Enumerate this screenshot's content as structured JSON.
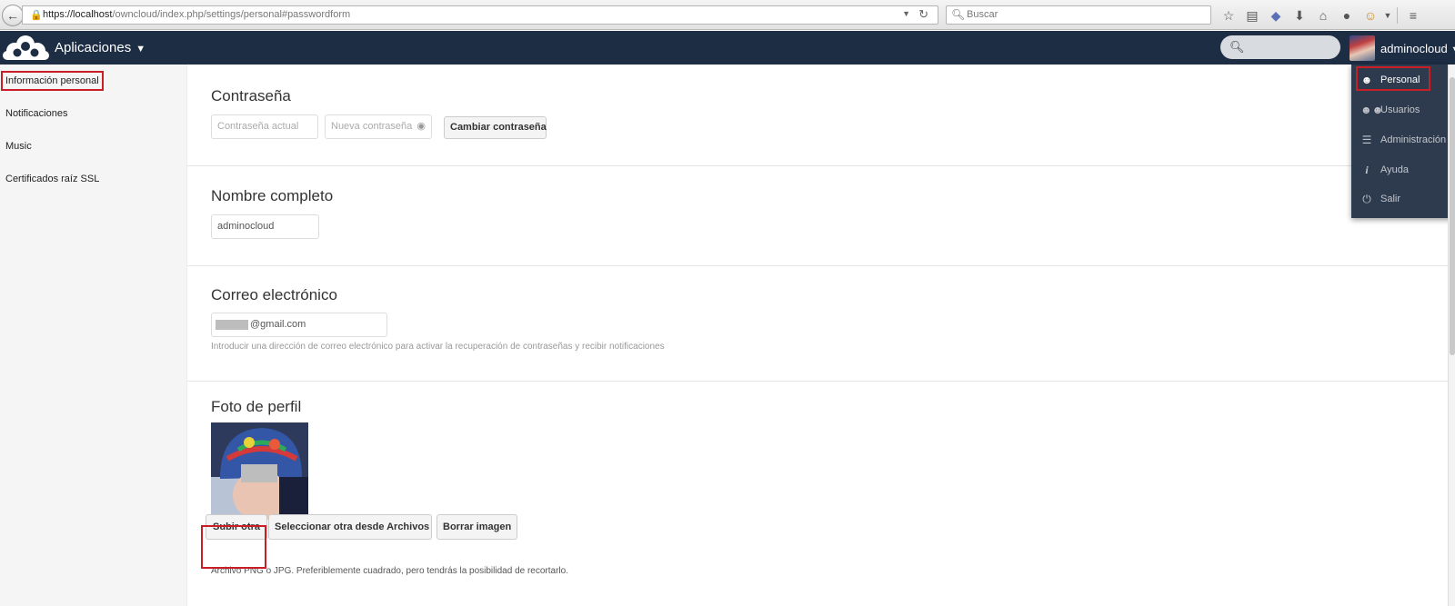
{
  "browser": {
    "url_host": "https://localhost",
    "url_path": "/owncloud/index.php/settings/personal#passwordform",
    "search_placeholder": "Buscar",
    "toolbar_icons": [
      "bookmark-star-icon",
      "reading-list-icon",
      "pocket-icon",
      "download-icon",
      "home-icon",
      "chat-icon",
      "monkey-icon",
      "menu-icon"
    ]
  },
  "header": {
    "apps_label": "Aplicaciones",
    "apps_caret": "▼",
    "user_name": "adminocloud",
    "user_caret": "▼"
  },
  "sidebar": {
    "items": [
      {
        "label": "Información personal"
      },
      {
        "label": "Notificaciones"
      },
      {
        "label": "Music"
      },
      {
        "label": "Certificados raíz SSL"
      }
    ]
  },
  "password_section": {
    "title": "Contraseña",
    "current_placeholder": "Contraseña actual",
    "new_placeholder": "Nueva contraseña",
    "change_button": "Cambiar contraseña"
  },
  "fullname_section": {
    "title": "Nombre completo",
    "value": "adminocloud"
  },
  "email_section": {
    "title": "Correo electrónico",
    "value_suffix": "@gmail.com",
    "hint": "Introducir una dirección de correo electrónico para activar la recuperación de contraseñas y recibir notificaciones"
  },
  "photo_section": {
    "title": "Foto de perfil",
    "upload_button": "Subir otra",
    "select_button": "Seleccionar otra desde Archivos",
    "remove_button": "Borrar imagen",
    "hint": "Archivo PNG o JPG. Preferiblemente cuadrado, pero tendrás la posibilidad de recortarlo."
  },
  "user_menu": {
    "items": [
      {
        "label": "Personal",
        "icon": "person-icon"
      },
      {
        "label": "Usuarios",
        "icon": "users-icon"
      },
      {
        "label": "Administración",
        "icon": "list-icon"
      },
      {
        "label": "Ayuda",
        "icon": "info-icon"
      },
      {
        "label": "Salir",
        "icon": "power-icon"
      }
    ]
  },
  "colors": {
    "header_bg": "#1d2d44",
    "highlight": "#c81f26",
    "dropdown_bg": "#2e3b4f"
  }
}
